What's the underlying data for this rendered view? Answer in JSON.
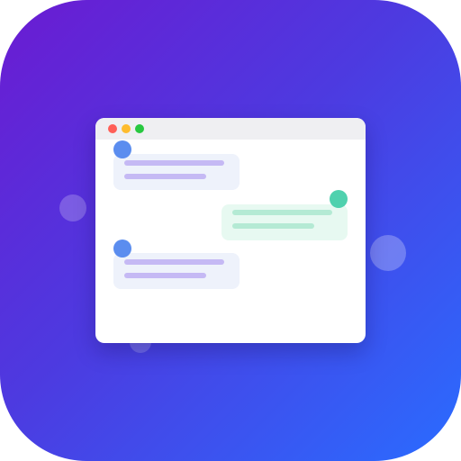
{
  "colors": {
    "gradient_start": "#6b1bd2",
    "gradient_end": "#2a6cff",
    "window_bg": "#ffffff",
    "titlebar_bg": "#efeff2",
    "dot_red": "#ff5f57",
    "dot_yellow": "#febc2e",
    "dot_green": "#28c840",
    "incoming_avatar": "#5b8def",
    "outgoing_avatar": "#4fd1ae",
    "incoming_bubble": "#eef2fb",
    "outgoing_bubble": "#e7f9f1"
  },
  "icons": {
    "window_controls": [
      "close-dot-icon",
      "minimize-dot-icon",
      "maximize-dot-icon"
    ],
    "avatars": [
      "user-avatar-icon",
      "contact-avatar-icon"
    ]
  },
  "chat": {
    "messages": [
      {
        "side": "left",
        "text_lines": 2
      },
      {
        "side": "right",
        "text_lines": 2
      },
      {
        "side": "left",
        "text_lines": 2
      }
    ]
  }
}
